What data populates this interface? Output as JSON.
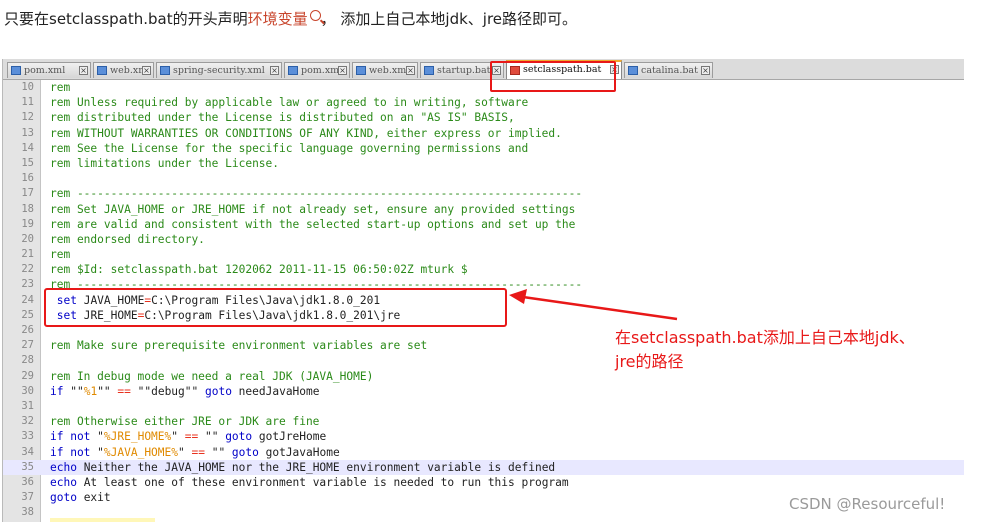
{
  "intro": {
    "before": "只要在setclasspath.bat的开头声明",
    "keyword": "环境变量",
    "after": "， 添加上自己本地jdk、jre路径即可。"
  },
  "tabs": [
    {
      "label": "pom.xml",
      "active": false
    },
    {
      "label": "web.xml",
      "active": false
    },
    {
      "label": "spring-security.xml",
      "active": false
    },
    {
      "label": "pom.xml",
      "active": false
    },
    {
      "label": "web.xml",
      "active": false
    },
    {
      "label": "startup.bat",
      "active": false
    },
    {
      "label": "setclasspath.bat",
      "active": true
    },
    {
      "label": "catalina.bat",
      "active": false
    }
  ],
  "close_glyph": "×",
  "lines": [
    {
      "num": "10",
      "segs": [
        [
          "c",
          "rem"
        ]
      ]
    },
    {
      "num": "11",
      "segs": [
        [
          "c",
          "rem Unless required by applicable law or agreed to in writing, software"
        ]
      ]
    },
    {
      "num": "12",
      "segs": [
        [
          "c",
          "rem distributed under the License is distributed on an \"AS IS\" BASIS,"
        ]
      ]
    },
    {
      "num": "13",
      "segs": [
        [
          "c",
          "rem WITHOUT WARRANTIES OR CONDITIONS OF ANY KIND, either express or implied."
        ]
      ]
    },
    {
      "num": "14",
      "segs": [
        [
          "c",
          "rem See the License for the specific language governing permissions and"
        ]
      ]
    },
    {
      "num": "15",
      "segs": [
        [
          "c",
          "rem limitations under the License."
        ]
      ]
    },
    {
      "num": "16",
      "segs": []
    },
    {
      "num": "17",
      "segs": [
        [
          "c",
          "rem ---------------------------------------------------------------------------"
        ]
      ]
    },
    {
      "num": "18",
      "segs": [
        [
          "c",
          "rem Set JAVA_HOME or JRE_HOME if not already set, ensure any provided settings"
        ]
      ]
    },
    {
      "num": "19",
      "segs": [
        [
          "c",
          "rem are valid and consistent with the selected start-up options and set up the"
        ]
      ]
    },
    {
      "num": "20",
      "segs": [
        [
          "c",
          "rem endorsed directory."
        ]
      ]
    },
    {
      "num": "21",
      "segs": [
        [
          "c",
          "rem"
        ]
      ]
    },
    {
      "num": "22",
      "segs": [
        [
          "c",
          "rem $Id: setclasspath.bat 1202062 2011-11-15 06:50:02Z mturk $"
        ]
      ]
    },
    {
      "num": "23",
      "segs": [
        [
          "c",
          "rem ---------------------------------------------------------------------------"
        ]
      ]
    },
    {
      "num": "24",
      "segs": [
        [
          "e",
          " "
        ],
        [
          "k",
          "set"
        ],
        [
          "e",
          " JAVA_HOME"
        ],
        [
          "o",
          "="
        ],
        [
          "e",
          "C:\\Program Files\\Java\\jdk1.8.0_201"
        ]
      ]
    },
    {
      "num": "25",
      "segs": [
        [
          "e",
          " "
        ],
        [
          "k",
          "set"
        ],
        [
          "e",
          " JRE_HOME"
        ],
        [
          "o",
          "="
        ],
        [
          "e",
          "C:\\Program Files\\Java\\jdk1.8.0_201\\jre"
        ]
      ]
    },
    {
      "num": "26",
      "segs": []
    },
    {
      "num": "27",
      "segs": [
        [
          "c",
          "rem Make sure prerequisite environment variables are set"
        ]
      ]
    },
    {
      "num": "28",
      "segs": []
    },
    {
      "num": "29",
      "segs": [
        [
          "c",
          "rem In debug mode we need a real JDK (JAVA_HOME)"
        ]
      ]
    },
    {
      "num": "30",
      "segs": [
        [
          "k",
          "if"
        ],
        [
          "e",
          " \"\""
        ],
        [
          "v",
          "%1"
        ],
        [
          "e",
          "\"\" "
        ],
        [
          "o",
          "=="
        ],
        [
          "e",
          " \"\"debug\"\" "
        ],
        [
          "k",
          "goto"
        ],
        [
          "e",
          " needJavaHome"
        ]
      ]
    },
    {
      "num": "31",
      "segs": []
    },
    {
      "num": "32",
      "segs": [
        [
          "c",
          "rem Otherwise either JRE or JDK are fine"
        ]
      ]
    },
    {
      "num": "33",
      "segs": [
        [
          "k",
          "if not"
        ],
        [
          "e",
          " \""
        ],
        [
          "v",
          "%JRE_HOME%"
        ],
        [
          "e",
          "\" "
        ],
        [
          "o",
          "=="
        ],
        [
          "e",
          " \"\" "
        ],
        [
          "k",
          "goto"
        ],
        [
          "e",
          " gotJreHome"
        ]
      ]
    },
    {
      "num": "34",
      "segs": [
        [
          "k",
          "if not"
        ],
        [
          "e",
          " \""
        ],
        [
          "v",
          "%JAVA_HOME%"
        ],
        [
          "e",
          "\" "
        ],
        [
          "o",
          "=="
        ],
        [
          "e",
          " \"\" "
        ],
        [
          "k",
          "goto"
        ],
        [
          "e",
          " gotJavaHome"
        ]
      ]
    },
    {
      "num": "35",
      "segs": [
        [
          "k",
          "echo"
        ],
        [
          "e",
          " Neither the JAVA_HOME nor the JRE_HOME environment variable is defined"
        ]
      ],
      "highlight": true
    },
    {
      "num": "36",
      "segs": [
        [
          "k",
          "echo"
        ],
        [
          "e",
          " At least one of these environment variable is needed to run this program"
        ]
      ]
    },
    {
      "num": "37",
      "segs": [
        [
          "k",
          "goto"
        ],
        [
          "e",
          " exit"
        ]
      ]
    },
    {
      "num": "38",
      "segs": []
    }
  ],
  "annotation": {
    "line1": "在setclasspath.bat添加上自己本地jdk、",
    "line2": "jre的路径"
  },
  "watermark": "CSDN @Resourceful!",
  "colors": {
    "comment": "#2b8a19",
    "keyword": "#0000c8",
    "variable": "#e08a00",
    "operator": "#e8321e",
    "annotation_red": "#e81818"
  }
}
